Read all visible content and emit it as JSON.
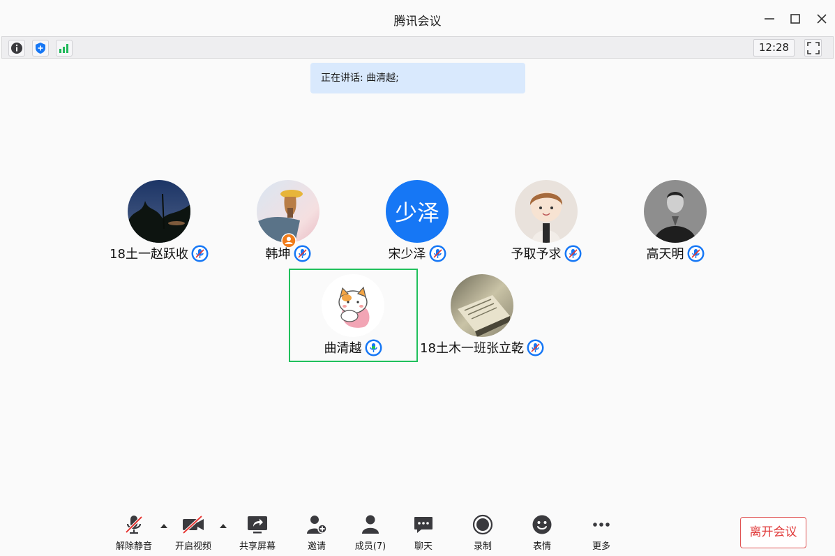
{
  "window": {
    "title": "腾讯会议"
  },
  "infobar": {
    "clock": "12:28"
  },
  "banner": {
    "speaking_text": "正在讲话: 曲清越;"
  },
  "participants": [
    {
      "name": "18土一赵跃收",
      "avatar_type": "photo-night-trees",
      "muted": true
    },
    {
      "name": "韩坤",
      "avatar_type": "photo-girl-straw-hat",
      "muted": true,
      "host": true
    },
    {
      "name": "宋少泽",
      "avatar_type": "text",
      "avatar_text": "少泽",
      "avatar_color": "#1677f5",
      "muted": true
    },
    {
      "name": "予取予求",
      "avatar_type": "cartoon-boy",
      "muted": true
    },
    {
      "name": "高天明",
      "avatar_type": "photo-man-bw",
      "muted": true
    },
    {
      "name": "曲清越",
      "avatar_type": "cartoon-cat",
      "muted": false,
      "speaking": true
    },
    {
      "name": "18土木一班张立乾",
      "avatar_type": "photo-book",
      "muted": true
    }
  ],
  "toolbar": {
    "unmute": "解除静音",
    "start_video": "开启视频",
    "share_screen": "共享屏幕",
    "invite": "邀请",
    "members": "成员(7)",
    "chat": "聊天",
    "record": "录制",
    "emoji": "表情",
    "more": "更多",
    "leave": "离开会议"
  },
  "colors": {
    "accent": "#1677f5",
    "speaking": "#20c05c",
    "danger": "#e03a3a",
    "banner": "#d9e9fd"
  }
}
